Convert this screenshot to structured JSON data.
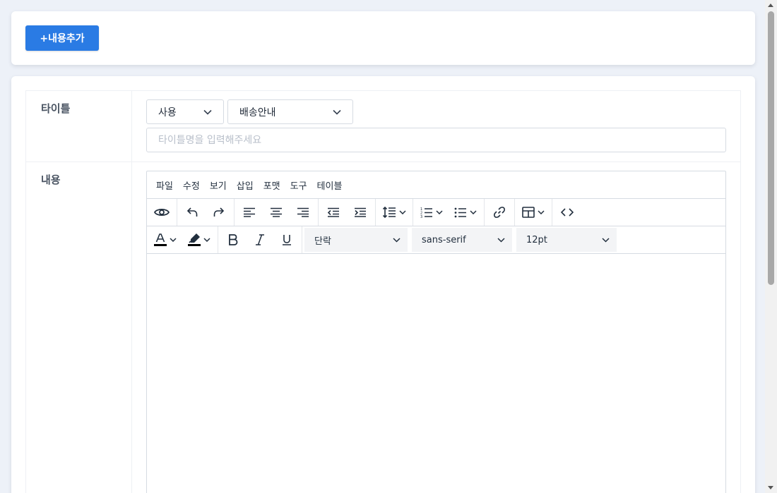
{
  "top": {
    "add_button_label": "+내용추가"
  },
  "form": {
    "title_label": "타이틀",
    "content_label": "내용",
    "use_select": "사용",
    "type_select": "배송안내",
    "title_input": {
      "value": "",
      "placeholder": "타이틀명을 입력해주세요"
    }
  },
  "editor": {
    "menu": [
      "파일",
      "수정",
      "보기",
      "삽입",
      "포맷",
      "도구",
      "테이블"
    ],
    "block_format": "단락",
    "font_family": "sans-serif",
    "font_size": "12pt",
    "icons": {
      "row1": [
        "preview-icon",
        "undo-icon",
        "redo-icon",
        "align-left-icon",
        "align-center-icon",
        "align-right-icon",
        "outdent-icon",
        "indent-icon",
        "line-height-icon",
        "numbered-list-icon",
        "bullet-list-icon",
        "link-icon",
        "table-icon",
        "source-code-icon"
      ],
      "row2": [
        "text-color-icon",
        "highlight-color-icon",
        "bold-icon",
        "italic-icon",
        "underline-icon"
      ]
    },
    "colors": {
      "text_color": "#000000",
      "highlight_color": "#000000"
    }
  },
  "colors": {
    "primary": "#2a7be4",
    "background": "#edf1f8"
  }
}
